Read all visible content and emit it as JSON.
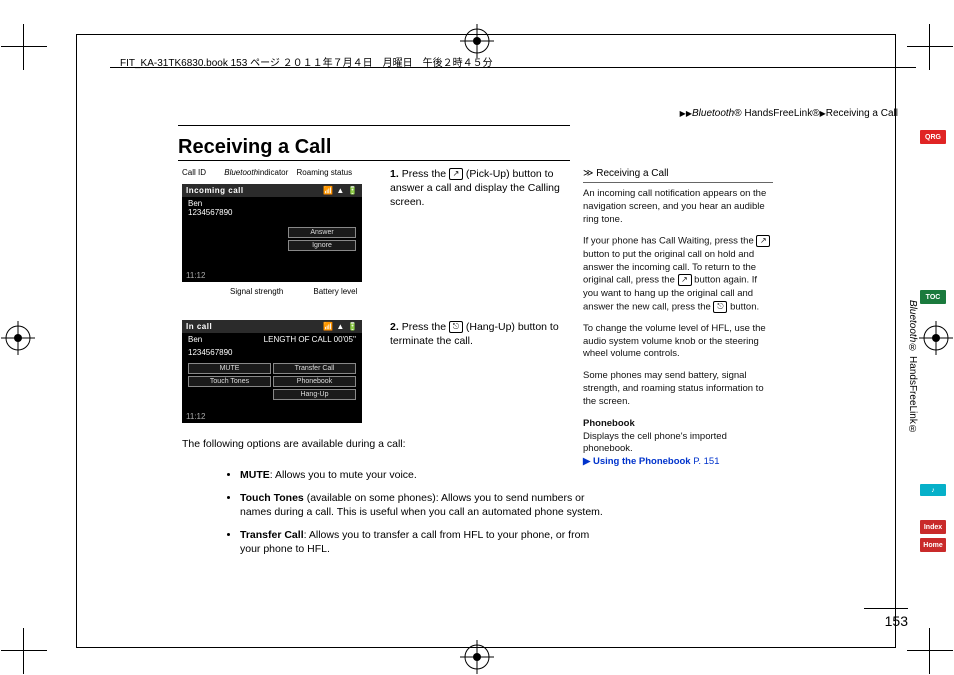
{
  "header": {
    "stamp": "FIT_KA-31TK6830.book  153 ページ  ２０１１年７月４日　月曜日　午後２時４５分",
    "breadcrumb_prefix": "▶▶",
    "breadcrumb_1": "Bluetooth",
    "breadcrumb_2": "® HandsFreeLink®",
    "breadcrumb_3": "▶",
    "breadcrumb_4": "Receiving a Call"
  },
  "title": "Receiving a Call",
  "callouts": {
    "call_id": "Call ID",
    "bt": "Bluetooth",
    "bt_after": " indicator",
    "roaming": "Roaming status",
    "signal": "Signal strength",
    "battery": "Battery level"
  },
  "shot1": {
    "title": "Incoming call",
    "name": "Ben",
    "number": "1234567890",
    "answer": "Answer",
    "ignore": "Ignore",
    "time": "11:12"
  },
  "shot2": {
    "title": "In call",
    "name": "Ben",
    "len": "LENGTH OF CALL 00'05''",
    "number": "1234567890",
    "mute": "MUTE",
    "transfer": "Transfer Call",
    "touch": "Touch Tones",
    "phonebook": "Phonebook",
    "hang": "Hang-Up",
    "time": "11:12"
  },
  "steps": {
    "s1a": "1.",
    "s1b": "Press the ",
    "s1c": " (Pick-Up) button to answer a call and display the Calling screen.",
    "s2a": "2.",
    "s2b": "Press the ",
    "s2c": " (Hang-Up) button to terminate the call."
  },
  "options_intro": "The following options are available during a call:",
  "bullets": {
    "b1_t": "MUTE",
    "b1_r": ": Allows you to mute your voice.",
    "b2_t": "Touch Tones",
    "b2_r": " (available on some phones): Allows you to send numbers or names during a call. This is useful when you call an automated phone system.",
    "b3_t": "Transfer Call",
    "b3_r": ": Allows you to transfer a call from HFL to your phone, or from your phone to HFL."
  },
  "side": {
    "head_icon": "≫",
    "head": "Receiving a Call",
    "p1": "An incoming call notification appears on the navigation screen, and you hear an audible ring tone.",
    "p2a": "If your phone has Call Waiting, press the ",
    "p2b": " button to put the original call on hold and answer the incoming call. To return to the original call, press the ",
    "p2c": " button again. If you want to hang up the original call and answer the new call, press the ",
    "p2d": " button.",
    "p3": "To change the volume level of HFL, use the audio system volume knob or the steering wheel volume controls.",
    "p4": "Some phones may send battery, signal strength, and roaming status information to the screen.",
    "pbh": "Phonebook",
    "pbt": "Displays the cell phone's imported phonebook.",
    "link_icon": "▶",
    "link": "Using the Phonebook",
    "linkp": " P. 151"
  },
  "vside": {
    "bt": "Bluetooth",
    "rest": "® HandsFreeLink®"
  },
  "pills": {
    "qrg": "QRG",
    "toc": "TOC",
    "nav": "♪",
    "idx": "Index",
    "home": "Home"
  },
  "pagenum": "153"
}
